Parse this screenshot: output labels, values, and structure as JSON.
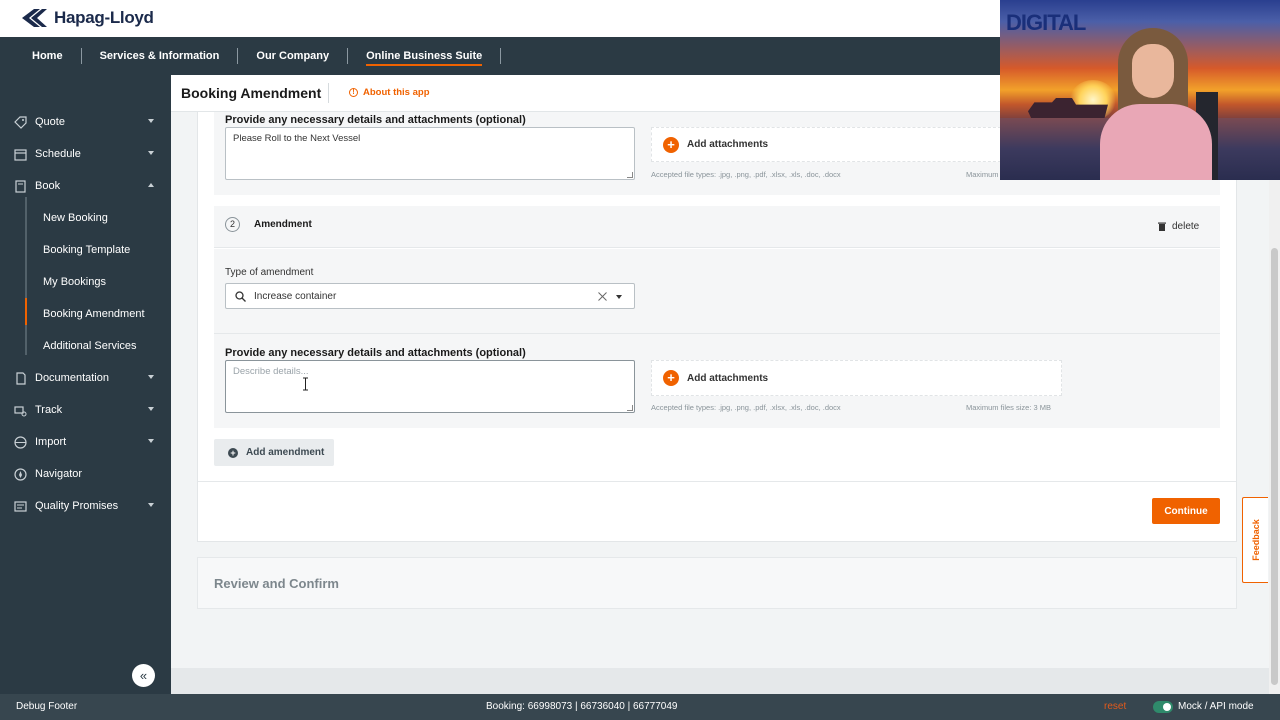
{
  "brand": {
    "name": "Hapag-Lloyd"
  },
  "nav": {
    "items": [
      {
        "label": "Home"
      },
      {
        "label": "Services & Information"
      },
      {
        "label": "Our Company"
      },
      {
        "label": "Online Business Suite",
        "active": true
      }
    ]
  },
  "sidebar": {
    "items": [
      {
        "label": "Quote",
        "icon": "tag-icon"
      },
      {
        "label": "Schedule",
        "icon": "calendar-icon"
      },
      {
        "label": "Book",
        "icon": "book-icon",
        "expanded": true
      },
      {
        "label": "Documentation",
        "icon": "document-icon"
      },
      {
        "label": "Track",
        "icon": "track-icon"
      },
      {
        "label": "Import",
        "icon": "import-icon"
      },
      {
        "label": "Navigator",
        "icon": "compass-icon"
      },
      {
        "label": "Quality Promises",
        "icon": "quality-icon"
      }
    ],
    "book_sub": [
      {
        "label": "New Booking"
      },
      {
        "label": "Booking Template"
      },
      {
        "label": "My Bookings"
      },
      {
        "label": "Booking Amendment",
        "active": true
      },
      {
        "label": "Additional Services"
      }
    ],
    "collapse_glyph": "«"
  },
  "page": {
    "title": "Booking Amendment",
    "about_label": "About this app"
  },
  "amendment1": {
    "details_label": "Provide any necessary details and attachments (optional)",
    "details_value": "Please Roll to the Next Vessel",
    "attach_label": "Add attachments",
    "accepted_types": "Accepted file types: .jpg, .png, .pdf, .xlsx, .xls, .doc, .docx",
    "max_size_partial": "Maximum"
  },
  "amendment2": {
    "number": "2",
    "title": "Amendment",
    "delete_label": "delete",
    "type_label": "Type of amendment",
    "type_value": "Increase container",
    "details_label": "Provide any necessary details and attachments (optional)",
    "details_placeholder": "Describe details...",
    "attach_label": "Add attachments",
    "accepted_types": "Accepted file types: .jpg, .png, .pdf, .xlsx, .xls, .doc, .docx",
    "max_size": "Maximum files size: 3 MB"
  },
  "actions": {
    "add_amendment": "Add amendment",
    "continue": "Continue"
  },
  "review": {
    "title": "Review and Confirm"
  },
  "feedback": {
    "label": "Feedback"
  },
  "footer": {
    "left": "Debug Footer",
    "booking": "Booking: 66998073 | 66736040 | 66777049",
    "reset": "reset",
    "mode": "Mock / API mode"
  },
  "video_overlay": {
    "text": "DIGITAL"
  },
  "colors": {
    "accent": "#f06200",
    "nav_bg": "#2b3a44",
    "footer_bg": "#37464f"
  }
}
